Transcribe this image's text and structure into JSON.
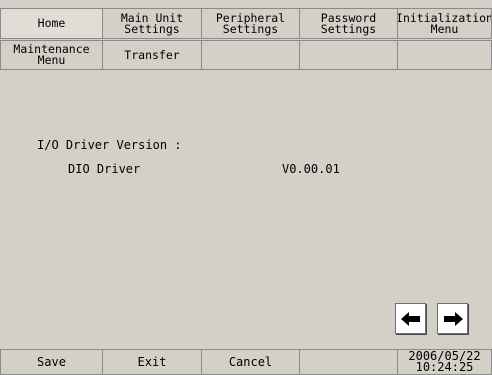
{
  "tabs_row1": [
    {
      "label": "Home"
    },
    {
      "label": "Main Unit\nSettings"
    },
    {
      "label": "Peripheral\nSettings"
    },
    {
      "label": "Password\nSettings"
    },
    {
      "label": "Initialization\nMenu"
    }
  ],
  "tabs_row2": [
    {
      "label": "Maintenance\nMenu"
    },
    {
      "label": "Transfer"
    },
    {
      "label": ""
    },
    {
      "label": ""
    },
    {
      "label": ""
    }
  ],
  "content": {
    "title": "I/O Driver Version :",
    "driver_name": "DIO Driver",
    "driver_version": "V0.00.01"
  },
  "nav": {
    "prev_icon": "arrow-left-icon",
    "next_icon": "arrow-right-icon"
  },
  "bottom_bar": {
    "save_label": "Save",
    "exit_label": "Exit",
    "cancel_label": "Cancel",
    "empty_label": "",
    "date": "2006/05/22",
    "time": "10:24:25"
  }
}
